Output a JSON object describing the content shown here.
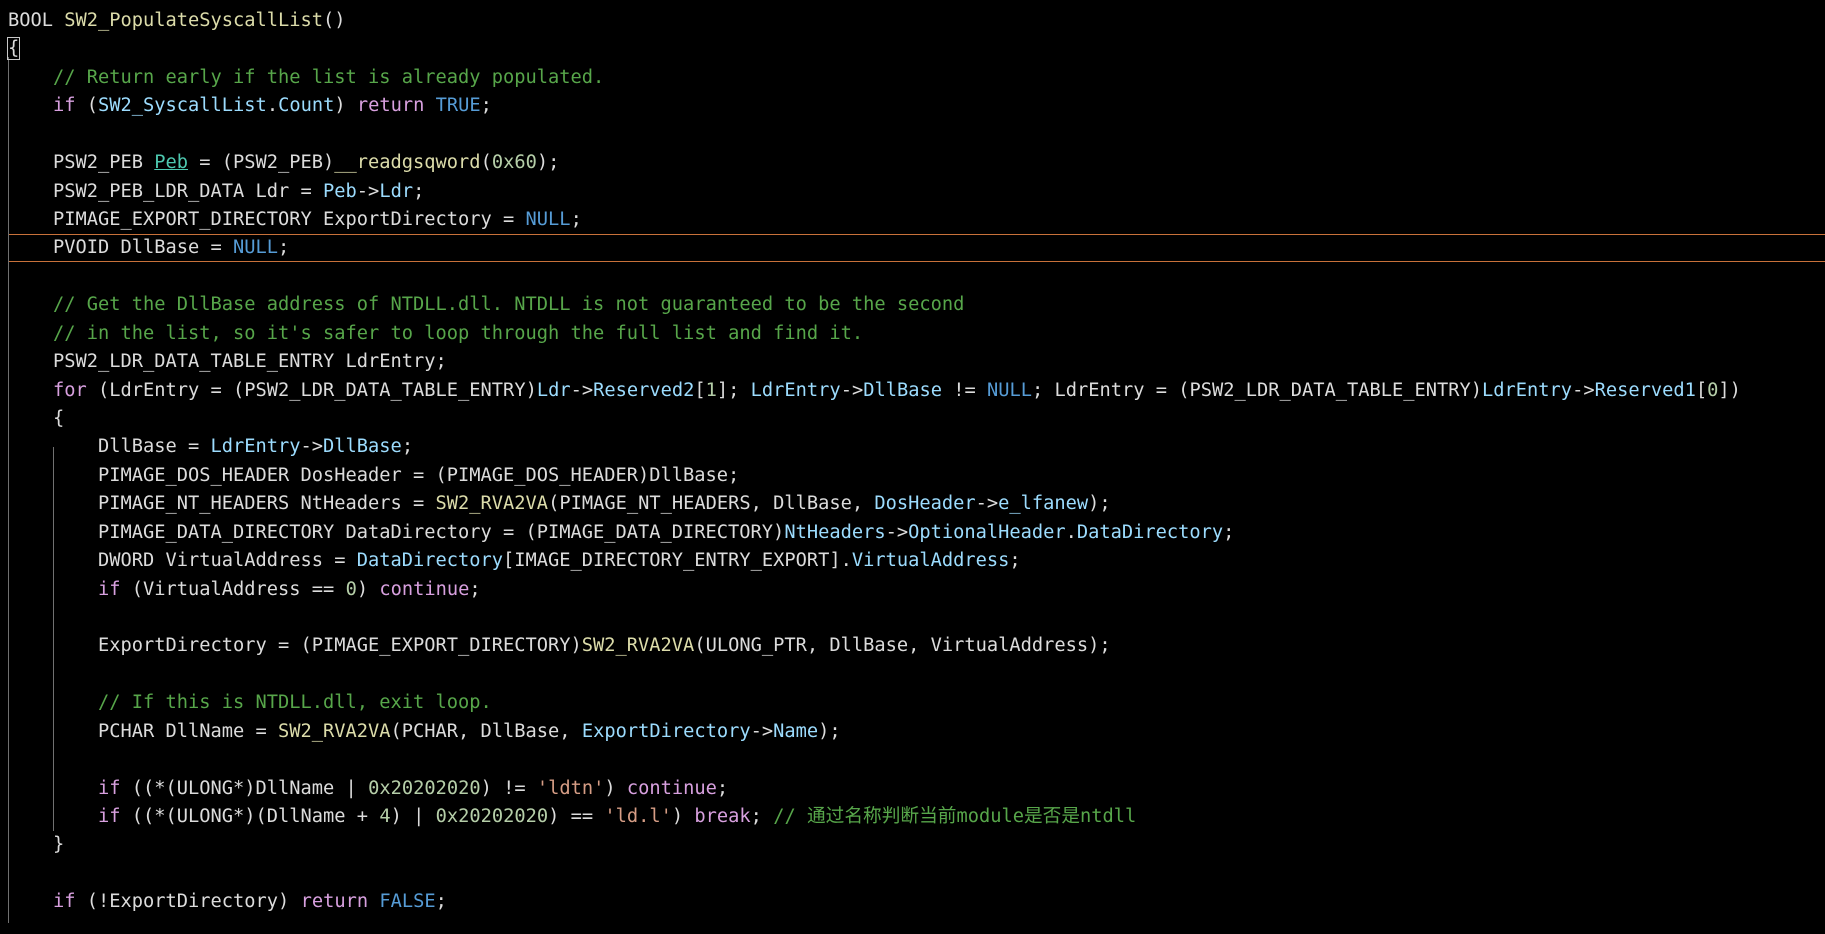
{
  "editor": {
    "theme": {
      "background": "#000000",
      "current_line_border": "#c8713a",
      "indent_guide": "#707070"
    },
    "lines": [
      {
        "tokens": [
          {
            "t": "BOOL ",
            "c": "plain"
          },
          {
            "t": "SW2_PopulateSyscallList",
            "c": "fn"
          },
          {
            "t": "()",
            "c": "plain"
          }
        ]
      },
      {
        "tokens": [
          {
            "t": "{",
            "c": "plain",
            "caret": true
          }
        ]
      },
      {
        "tokens": [
          {
            "t": "    ",
            "c": "plain"
          },
          {
            "t": "// Return early if the list is already populated.",
            "c": "com"
          }
        ]
      },
      {
        "tokens": [
          {
            "t": "    ",
            "c": "plain"
          },
          {
            "t": "if",
            "c": "flow"
          },
          {
            "t": " (",
            "c": "plain"
          },
          {
            "t": "SW2_SyscallList",
            "c": "ref"
          },
          {
            "t": ".",
            "c": "plain"
          },
          {
            "t": "Count",
            "c": "ref"
          },
          {
            "t": ") ",
            "c": "plain"
          },
          {
            "t": "return",
            "c": "flow"
          },
          {
            "t": " ",
            "c": "plain"
          },
          {
            "t": "TRUE",
            "c": "kw"
          },
          {
            "t": ";",
            "c": "plain"
          }
        ]
      },
      {
        "tokens": []
      },
      {
        "tokens": [
          {
            "t": "    PSW2_PEB ",
            "c": "plain"
          },
          {
            "t": "Peb",
            "c": "link"
          },
          {
            "t": " = (PSW2_PEB)",
            "c": "plain"
          },
          {
            "t": "__readgsqword",
            "c": "fn"
          },
          {
            "t": "(",
            "c": "plain"
          },
          {
            "t": "0x60",
            "c": "num"
          },
          {
            "t": ");",
            "c": "plain"
          }
        ]
      },
      {
        "tokens": [
          {
            "t": "    PSW2_PEB_LDR_DATA Ldr = ",
            "c": "plain"
          },
          {
            "t": "Peb",
            "c": "ref"
          },
          {
            "t": "->",
            "c": "plain"
          },
          {
            "t": "Ldr",
            "c": "ref"
          },
          {
            "t": ";",
            "c": "plain"
          }
        ]
      },
      {
        "tokens": [
          {
            "t": "    PIMAGE_EXPORT_DIRECTORY ExportDirectory = ",
            "c": "plain"
          },
          {
            "t": "NULL",
            "c": "kw"
          },
          {
            "t": ";",
            "c": "plain"
          }
        ]
      },
      {
        "tokens": [
          {
            "t": "    PVOID DllBase = ",
            "c": "plain"
          },
          {
            "t": "NULL",
            "c": "kw"
          },
          {
            "t": ";",
            "c": "plain"
          }
        ],
        "current": true
      },
      {
        "tokens": []
      },
      {
        "tokens": [
          {
            "t": "    ",
            "c": "plain"
          },
          {
            "t": "// Get the DllBase address of NTDLL.dll. NTDLL is not guaranteed to be the second",
            "c": "com"
          }
        ]
      },
      {
        "tokens": [
          {
            "t": "    ",
            "c": "plain"
          },
          {
            "t": "// in the list, so it's safer to loop through the full list and find it.",
            "c": "com"
          }
        ]
      },
      {
        "tokens": [
          {
            "t": "    PSW2_LDR_DATA_TABLE_ENTRY LdrEntry;",
            "c": "plain"
          }
        ]
      },
      {
        "tokens": [
          {
            "t": "    ",
            "c": "plain"
          },
          {
            "t": "for",
            "c": "flow"
          },
          {
            "t": " (LdrEntry = (PSW2_LDR_DATA_TABLE_ENTRY)",
            "c": "plain"
          },
          {
            "t": "Ldr",
            "c": "ref"
          },
          {
            "t": "->",
            "c": "plain"
          },
          {
            "t": "Reserved2",
            "c": "ref"
          },
          {
            "t": "[",
            "c": "plain"
          },
          {
            "t": "1",
            "c": "num"
          },
          {
            "t": "]; ",
            "c": "plain"
          },
          {
            "t": "LdrEntry",
            "c": "ref"
          },
          {
            "t": "->",
            "c": "plain"
          },
          {
            "t": "DllBase",
            "c": "ref"
          },
          {
            "t": " != ",
            "c": "plain"
          },
          {
            "t": "NULL",
            "c": "kw"
          },
          {
            "t": "; LdrEntry = (PSW2_LDR_DATA_TABLE_ENTRY)",
            "c": "plain"
          },
          {
            "t": "LdrEntry",
            "c": "ref"
          },
          {
            "t": "->",
            "c": "plain"
          },
          {
            "t": "Reserved1",
            "c": "ref"
          },
          {
            "t": "[",
            "c": "plain"
          },
          {
            "t": "0",
            "c": "num"
          },
          {
            "t": "])",
            "c": "plain"
          }
        ]
      },
      {
        "tokens": [
          {
            "t": "    {",
            "c": "plain"
          }
        ]
      },
      {
        "tokens": [
          {
            "t": "        DllBase = ",
            "c": "plain"
          },
          {
            "t": "LdrEntry",
            "c": "ref"
          },
          {
            "t": "->",
            "c": "plain"
          },
          {
            "t": "DllBase",
            "c": "ref"
          },
          {
            "t": ";",
            "c": "plain"
          }
        ]
      },
      {
        "tokens": [
          {
            "t": "        PIMAGE_DOS_HEADER DosHeader = (PIMAGE_DOS_HEADER)DllBase;",
            "c": "plain"
          }
        ]
      },
      {
        "tokens": [
          {
            "t": "        PIMAGE_NT_HEADERS NtHeaders = ",
            "c": "plain"
          },
          {
            "t": "SW2_RVA2VA",
            "c": "fn"
          },
          {
            "t": "(PIMAGE_NT_HEADERS, DllBase, ",
            "c": "plain"
          },
          {
            "t": "DosHeader",
            "c": "ref"
          },
          {
            "t": "->",
            "c": "plain"
          },
          {
            "t": "e_lfanew",
            "c": "ref"
          },
          {
            "t": ");",
            "c": "plain"
          }
        ]
      },
      {
        "tokens": [
          {
            "t": "        PIMAGE_DATA_DIRECTORY DataDirectory = (PIMAGE_DATA_DIRECTORY)",
            "c": "plain"
          },
          {
            "t": "NtHeaders",
            "c": "ref"
          },
          {
            "t": "->",
            "c": "plain"
          },
          {
            "t": "OptionalHeader",
            "c": "ref"
          },
          {
            "t": ".",
            "c": "plain"
          },
          {
            "t": "DataDirectory",
            "c": "ref"
          },
          {
            "t": ";",
            "c": "plain"
          }
        ]
      },
      {
        "tokens": [
          {
            "t": "        DWORD VirtualAddress = ",
            "c": "plain"
          },
          {
            "t": "DataDirectory",
            "c": "ref"
          },
          {
            "t": "[IMAGE_DIRECTORY_ENTRY_EXPORT].",
            "c": "plain"
          },
          {
            "t": "VirtualAddress",
            "c": "ref"
          },
          {
            "t": ";",
            "c": "plain"
          }
        ]
      },
      {
        "tokens": [
          {
            "t": "        ",
            "c": "plain"
          },
          {
            "t": "if",
            "c": "flow"
          },
          {
            "t": " (VirtualAddress == ",
            "c": "plain"
          },
          {
            "t": "0",
            "c": "num"
          },
          {
            "t": ") ",
            "c": "plain"
          },
          {
            "t": "continue",
            "c": "flow"
          },
          {
            "t": ";",
            "c": "plain"
          }
        ]
      },
      {
        "tokens": []
      },
      {
        "tokens": [
          {
            "t": "        ExportDirectory = (PIMAGE_EXPORT_DIRECTORY)",
            "c": "plain"
          },
          {
            "t": "SW2_RVA2VA",
            "c": "fn"
          },
          {
            "t": "(ULONG_PTR, DllBase, VirtualAddress);",
            "c": "plain"
          }
        ]
      },
      {
        "tokens": []
      },
      {
        "tokens": [
          {
            "t": "        ",
            "c": "plain"
          },
          {
            "t": "// If this is NTDLL.dll, exit loop.",
            "c": "com"
          }
        ]
      },
      {
        "tokens": [
          {
            "t": "        PCHAR DllName = ",
            "c": "plain"
          },
          {
            "t": "SW2_RVA2VA",
            "c": "fn"
          },
          {
            "t": "(PCHAR, DllBase, ",
            "c": "plain"
          },
          {
            "t": "ExportDirectory",
            "c": "ref"
          },
          {
            "t": "->",
            "c": "plain"
          },
          {
            "t": "Name",
            "c": "ref"
          },
          {
            "t": ");",
            "c": "plain"
          }
        ]
      },
      {
        "tokens": []
      },
      {
        "tokens": [
          {
            "t": "        ",
            "c": "plain"
          },
          {
            "t": "if",
            "c": "flow"
          },
          {
            "t": " ((*(ULONG*)DllName | ",
            "c": "plain"
          },
          {
            "t": "0x20202020",
            "c": "num"
          },
          {
            "t": ") != ",
            "c": "plain"
          },
          {
            "t": "'ldtn'",
            "c": "str"
          },
          {
            "t": ") ",
            "c": "plain"
          },
          {
            "t": "continue",
            "c": "flow"
          },
          {
            "t": ";",
            "c": "plain"
          }
        ]
      },
      {
        "tokens": [
          {
            "t": "        ",
            "c": "plain"
          },
          {
            "t": "if",
            "c": "flow"
          },
          {
            "t": " ((*(ULONG*)(DllName + ",
            "c": "plain"
          },
          {
            "t": "4",
            "c": "num"
          },
          {
            "t": ") | ",
            "c": "plain"
          },
          {
            "t": "0x20202020",
            "c": "num"
          },
          {
            "t": ") == ",
            "c": "plain"
          },
          {
            "t": "'ld.l'",
            "c": "str"
          },
          {
            "t": ") ",
            "c": "plain"
          },
          {
            "t": "break",
            "c": "flow"
          },
          {
            "t": "; ",
            "c": "plain"
          },
          {
            "t": "// 通过名称判断当前module是否是ntdll",
            "c": "com"
          }
        ]
      },
      {
        "tokens": [
          {
            "t": "    }",
            "c": "plain"
          }
        ]
      },
      {
        "tokens": []
      },
      {
        "tokens": [
          {
            "t": "    ",
            "c": "plain"
          },
          {
            "t": "if",
            "c": "flow"
          },
          {
            "t": " (!ExportDirectory) ",
            "c": "plain"
          },
          {
            "t": "return",
            "c": "flow"
          },
          {
            "t": " ",
            "c": "plain"
          },
          {
            "t": "FALSE",
            "c": "kw"
          },
          {
            "t": ";",
            "c": "plain"
          }
        ]
      }
    ]
  }
}
